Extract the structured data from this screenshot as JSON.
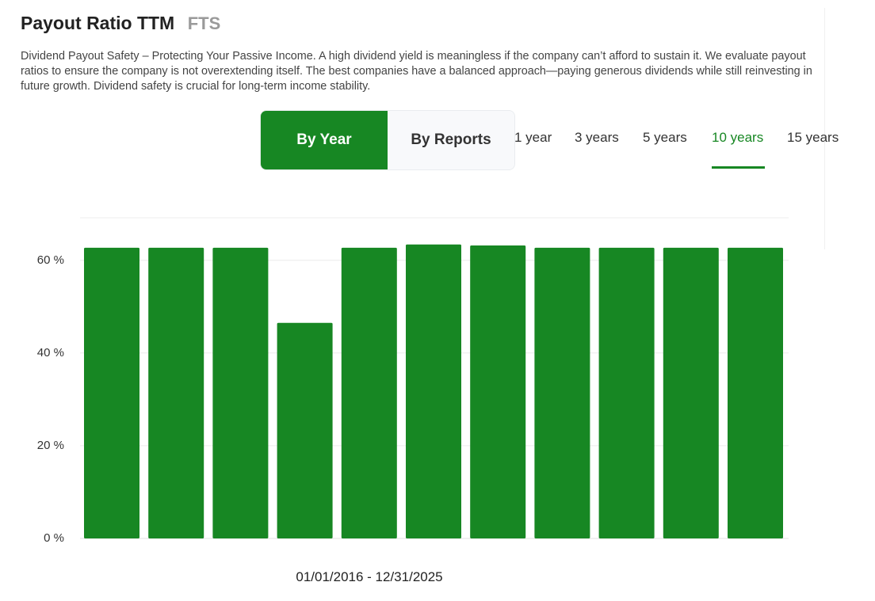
{
  "header": {
    "title": "Payout Ratio TTM",
    "ticker": "FTS"
  },
  "description": "Dividend Payout Safety – Protecting Your Passive Income. A high dividend yield is meaningless if the company can’t afford to sustain it. We evaluate payout ratios to ensure the company is not overextending itself. The best companies have a balanced approach—paying generous dividends while still reinvesting in future growth. Dividend safety is crucial for long-term income stability.",
  "view_toggle": {
    "by_year": "By Year",
    "by_reports": "By Reports",
    "selected": "By Year"
  },
  "ranges": {
    "items": [
      "1 year",
      "3 years",
      "5 years",
      "10 years",
      "15  years"
    ],
    "selected": "10 years"
  },
  "colors": {
    "accent": "#178723",
    "bar": "#178723",
    "grid": "#ececec"
  },
  "chart_data": {
    "type": "bar",
    "series": [
      {
        "values": [
          62.7,
          62.7,
          62.7,
          46.5,
          62.7,
          63.4,
          63.2,
          62.7,
          62.7,
          62.7,
          62.7
        ]
      }
    ],
    "y_ticks": [
      "0 %",
      "20 %",
      "40 %",
      "60 %"
    ],
    "ylim": [
      0,
      69
    ],
    "date_range": "01/01/2016 - 12/31/2025",
    "grid": true,
    "legend": "none"
  }
}
